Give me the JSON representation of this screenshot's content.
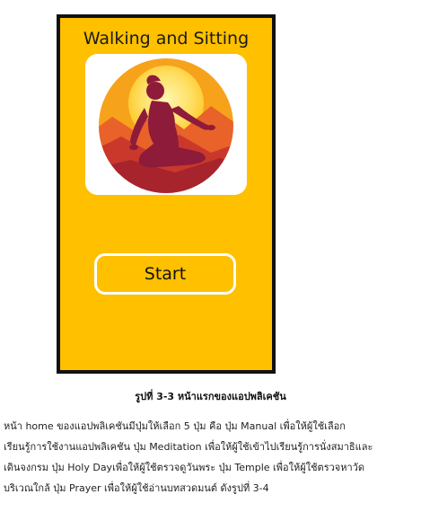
{
  "app": {
    "title": "Walking and Sitting",
    "start_label": "Start",
    "logo_icon": "meditation-silhouette-icon",
    "background_color": "#ffc000"
  },
  "figure": {
    "caption": "รูปที่ 3-3 หน้าแรกของแอปพลิเคชัน"
  },
  "body_text": {
    "lines": [
      "หน้า home ของแอปพลิเคชันมีปุ่มให้เลือก 5 ปุ่ม คือ ปุ่ม Manual เพื่อให้ผู้ใช้เลือก",
      "เรียนรู้การใช้งานแอปพลิเคชัน ปุ่ม Meditation เพื่อให้ผู้ใช้เข้าไปเรียนรู้การนั่งสมาธิและ",
      "เดินจงกรม ปุ่ม Holy Dayเพื่อให้ผู้ใช้ตรวจดูวันพระ ปุ่ม Temple เพื่อให้ผู้ใช้ตรวจหาวัด",
      "บริเวณใกล้ ปุ่ม Prayer เพื่อให้ผู้ใช้อ่านบทสวดมนต์ ดังรูปที่ 3-4"
    ]
  }
}
